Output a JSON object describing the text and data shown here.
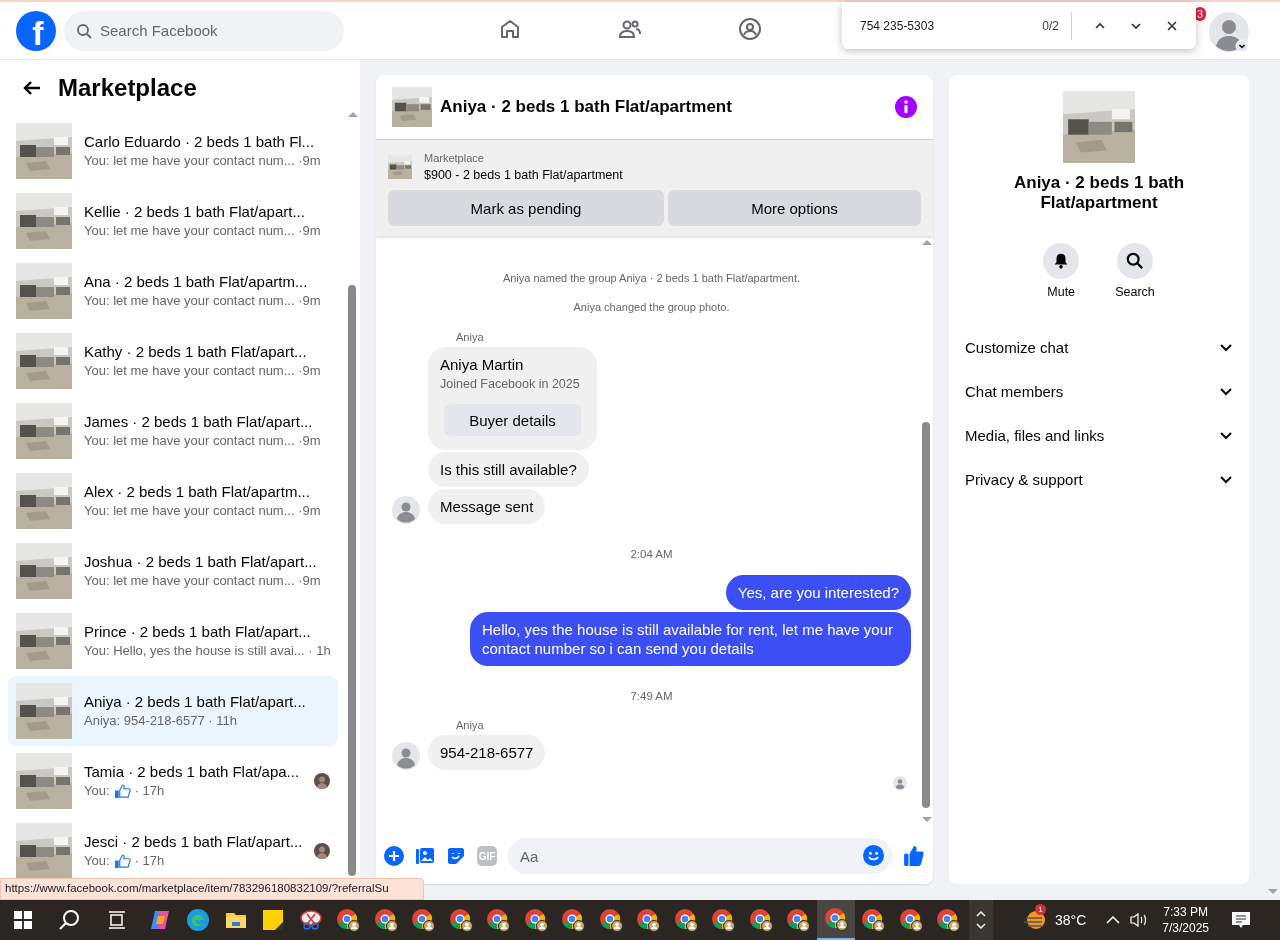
{
  "topbar": {
    "logo": "f",
    "search": {
      "placeholder": "Search Facebook"
    },
    "nav": [
      {
        "kind": "home",
        "selected": false
      },
      {
        "kind": "friends",
        "selected": false
      },
      {
        "kind": "groups",
        "selected": false
      }
    ],
    "notification_badge": "3"
  },
  "find_bar": {
    "value": "754 235-5303",
    "count": "0/2"
  },
  "sidebar": {
    "title": "Marketplace",
    "conversations": [
      {
        "title": "Carlo Eduardo · 2 beds 1 bath Fl...",
        "kind": "text",
        "preview": "You: let me have your contact num... ·9m",
        "selected": false,
        "seen": false
      },
      {
        "title": "Kellie · 2 beds 1 bath Flat/apart...",
        "kind": "text",
        "preview": "You: let me have your contact num... ·9m",
        "selected": false,
        "seen": false
      },
      {
        "title": "Ana · 2 beds 1 bath Flat/apartm...",
        "kind": "text",
        "preview": "You: let me have your contact num... ·9m",
        "selected": false,
        "seen": false
      },
      {
        "title": "Kathy · 2 beds 1 bath Flat/apart...",
        "kind": "text",
        "preview": "You: let me have your contact num... ·9m",
        "selected": false,
        "seen": false
      },
      {
        "title": "James · 2 beds 1 bath Flat/apart...",
        "kind": "text",
        "preview": "You: let me have your contact num... ·9m",
        "selected": false,
        "seen": false
      },
      {
        "title": "Alex · 2 beds 1 bath Flat/apartm...",
        "kind": "text",
        "preview": "You: let me have your contact num... ·9m",
        "selected": false,
        "seen": false
      },
      {
        "title": "Joshua · 2 beds 1 bath Flat/apart...",
        "kind": "text",
        "preview": "You: let me have your contact num... ·9m",
        "selected": false,
        "seen": false
      },
      {
        "title": "Prince · 2 beds 1 bath Flat/apart...",
        "kind": "text",
        "preview": "You: Hello, yes the house is still avai... · 1h",
        "selected": false,
        "seen": false
      },
      {
        "title": "Aniya · 2 beds 1 bath Flat/apart...",
        "kind": "text",
        "preview": "Aniya: 954-218-6577 · 11h",
        "selected": true,
        "seen": false
      },
      {
        "title": "Tamia · 2 beds 1 bath Flat/apa...",
        "kind": "like",
        "preview": "You:",
        "suffix": "· 17h",
        "selected": false,
        "seen": true
      },
      {
        "title": "Jesci · 2 beds 1 bath Flat/apart...",
        "kind": "like",
        "preview": "You:",
        "suffix": "· 17h",
        "selected": false,
        "seen": true
      }
    ]
  },
  "chat": {
    "title": "Aniya · 2 beds 1 bath Flat/apartment",
    "listing": {
      "label": "Marketplace",
      "text": "$900 - 2 beds 1 bath Flat/apartment",
      "buttons": [
        "Mark as pending",
        "More options"
      ]
    },
    "messages": [
      {
        "kind": "system",
        "text": "Aniya named the group Aniya · 2 beds 1 bath Flat/apartment."
      },
      {
        "kind": "system",
        "text": "Aniya changed the group photo."
      },
      {
        "kind": "sender",
        "text": "Aniya"
      },
      {
        "kind": "card",
        "text": "Aniya Martin",
        "sub": "Joined Facebook in 2025",
        "button": "Buyer details"
      },
      {
        "kind": "incoming",
        "text": "Is this still available?",
        "avatar": false
      },
      {
        "kind": "incoming",
        "text": "Message sent",
        "avatar": true
      },
      {
        "kind": "time",
        "text": "2:04 AM"
      },
      {
        "kind": "outgoing",
        "text": "Yes, are you interested?"
      },
      {
        "kind": "outgoing",
        "text": "Hello, yes the house is still available for rent, let me have your contact number so i can send you details"
      },
      {
        "kind": "time",
        "text": "7:49 AM"
      },
      {
        "kind": "sender",
        "text": "Aniya"
      },
      {
        "kind": "incoming",
        "text": "954-218-6577",
        "avatar": true
      },
      {
        "kind": "seen"
      }
    ],
    "composer": {
      "gif": "GIF",
      "placeholder": "Aa"
    }
  },
  "details": {
    "title": "Aniya · 2 beds 1 bath Flat/apartment",
    "actions": [
      {
        "kind": "mute",
        "label": "Mute"
      },
      {
        "kind": "search",
        "label": "Search"
      }
    ],
    "sections": [
      {
        "label": "Customize chat",
        "expanded": false
      },
      {
        "label": "Chat members",
        "expanded": false
      },
      {
        "label": "Media, files and links",
        "expanded": false
      },
      {
        "label": "Privacy & support",
        "expanded": false
      }
    ]
  },
  "status_url": "https://www.facebook.com/marketplace/item/783296180832109/?referralSu",
  "taskbar": {
    "apps": [
      {
        "kind": "copilot",
        "selected": false
      },
      {
        "kind": "edge",
        "selected": false
      },
      {
        "kind": "explorer",
        "selected": false
      },
      {
        "kind": "notes",
        "selected": false
      },
      {
        "kind": "snip",
        "selected": false
      },
      {
        "kind": "chrome",
        "selected": false
      },
      {
        "kind": "chrome",
        "selected": false
      },
      {
        "kind": "chrome",
        "selected": false
      },
      {
        "kind": "chrome",
        "selected": false
      },
      {
        "kind": "chrome",
        "selected": false
      },
      {
        "kind": "chrome",
        "selected": false
      },
      {
        "kind": "chrome",
        "selected": false
      },
      {
        "kind": "chrome",
        "selected": false
      },
      {
        "kind": "chrome",
        "selected": false
      },
      {
        "kind": "chrome",
        "selected": false
      },
      {
        "kind": "chrome",
        "selected": false
      },
      {
        "kind": "chrome",
        "selected": false
      },
      {
        "kind": "chrome",
        "selected": false
      },
      {
        "kind": "chrome",
        "selected": true
      },
      {
        "kind": "chrome",
        "selected": false
      },
      {
        "kind": "chrome",
        "selected": false
      },
      {
        "kind": "chrome",
        "selected": false
      }
    ],
    "weather_badge": "1",
    "temperature": "38°C",
    "time": "7:33 PM",
    "date": "7/3/2025"
  }
}
